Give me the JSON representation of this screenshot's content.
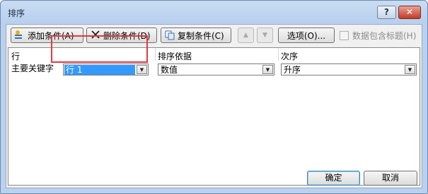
{
  "window": {
    "title": "排序",
    "help_label": "?",
    "close_label": "✕"
  },
  "toolbar": {
    "add_label": "添加条件(A)",
    "delete_label": "删除条件(D)",
    "copy_label": "复制条件(C)",
    "up_label": "▲",
    "down_label": "▼",
    "options_label": "选项(O)...",
    "header_checkbox_label": "数据包含标题(H)",
    "header_checkbox_checked": false
  },
  "grid": {
    "headers": {
      "row": "行",
      "sort_on": "排序依据",
      "order": "次序"
    },
    "rows": [
      {
        "label": "主要关键字",
        "column_value": "行 1",
        "sort_on_value": "数值",
        "order_value": "升序"
      }
    ]
  },
  "footer": {
    "ok_label": "确定",
    "cancel_label": "取消"
  },
  "colors": {
    "highlight_border": "#e0393e",
    "selection": "#3399ff"
  }
}
